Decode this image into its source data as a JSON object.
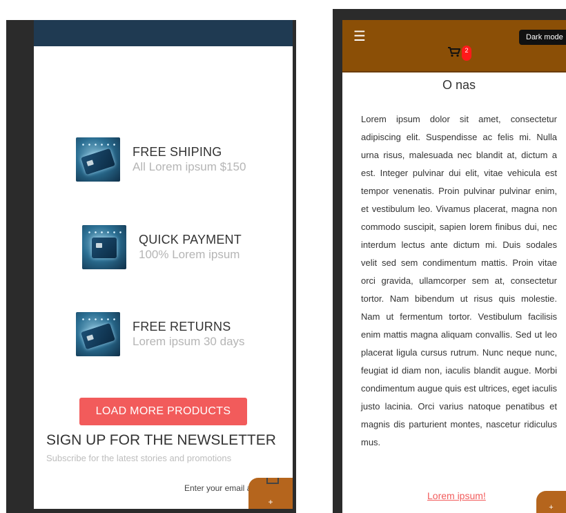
{
  "left_screen": {
    "features": [
      {
        "title": "FREE SHIPING",
        "subtitle": "All Lorem ipsum $150",
        "icon": "credit-card-image"
      },
      {
        "title": "QUICK PAYMENT",
        "subtitle": "100% Lorem ipsum",
        "icon": "payment-image"
      },
      {
        "title": "FREE RETURNS",
        "subtitle": "Lorem ipsum 30 days",
        "icon": "credit-card-image"
      }
    ],
    "load_more_label": "LOAD MORE PRODUCTS",
    "newsletter": {
      "title": "SIGN UP FOR THE NEWSLETTER",
      "subtitle": "Subscribe for the latest stories and promotions",
      "email_placeholder": "Enter your email ad"
    },
    "fab_label": "+"
  },
  "right_screen": {
    "header": {
      "menu_icon": "☰",
      "dark_mode_label": "Dark mode",
      "cart_count": "2"
    },
    "about": {
      "title": "O nas",
      "body": "Lorem ipsum dolor sit amet, consectetur adipiscing elit. Suspendisse ac felis mi. Nulla urna risus, malesuada nec blandit at, dictum a est. Integer pulvinar dui elit, vitae vehicula est tempor venenatis. Proin pulvinar pulvinar enim, et vestibulum leo. Vivamus placerat, magna non commodo suscipit, sapien lorem finibus dui, nec interdum lectus ante dictum mi. Duis sodales velit sed sem condimentum mattis. Proin vitae orci gravida, ullamcorper sem at, consectetur tortor. Nam bibendum ut risus quis molestie. Nam ut fermentum tortor. Vestibulum facilisis enim mattis magna aliquam convallis. Sed ut leo placerat ligula cursus rutrum. Nunc neque nunc, feugiat id diam non, iaculis blandit augue. Morbi condimentum augue quis est ultrices, eget iaculis justo lacinia. Orci varius natoque penatibus et magnis dis parturient montes, nascetur ridiculus mus.",
      "link_label": "Lorem ipsum!"
    },
    "fab_label": "+"
  },
  "colors": {
    "left_topbar": "#1f3a52",
    "header_brown": "#8b4f06",
    "accent_red": "#f25b5b",
    "fab_orange": "#b5651d",
    "badge_red": "#ff1a1a"
  }
}
